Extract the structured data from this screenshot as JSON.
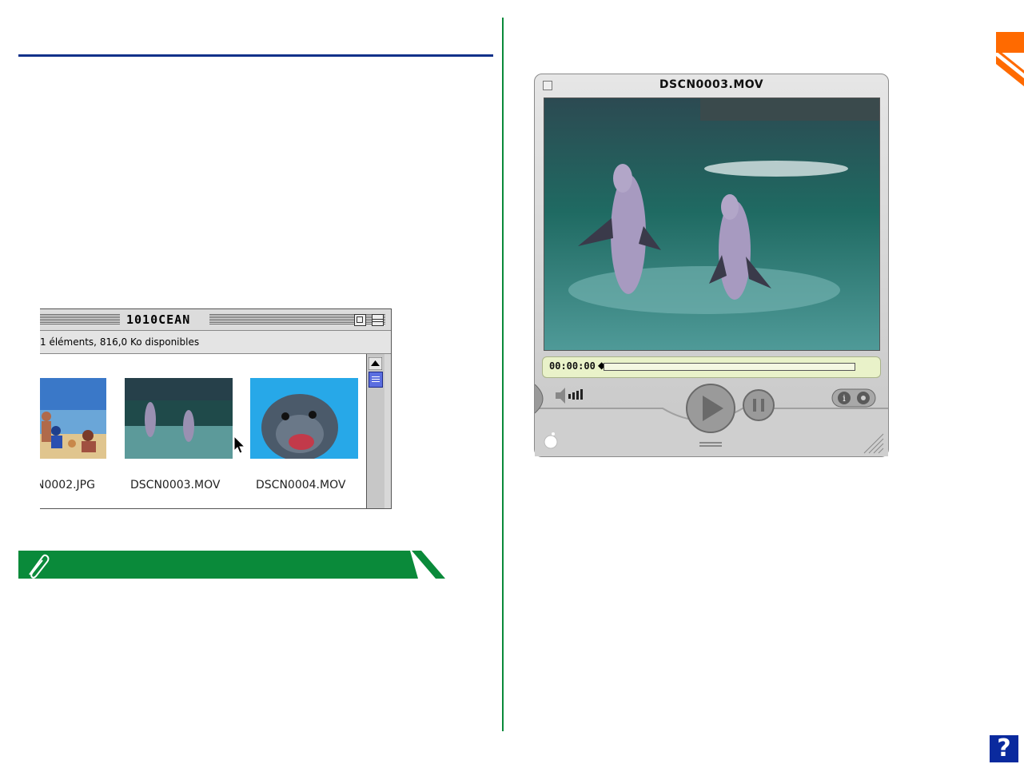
{
  "finder": {
    "title": "1010CEAN",
    "status": "1 éléments, 816,0 Ko disponibles",
    "files": [
      {
        "name": "N0002.JPG"
      },
      {
        "name": "DSCN0003.MOV"
      },
      {
        "name": "DSCN0004.MOV"
      }
    ]
  },
  "player": {
    "title": "DSCN0003.MOV",
    "timecode": "00:00:00",
    "playback_position": 0
  },
  "help": {
    "label": "?"
  },
  "colors": {
    "title_rule": "#10318a",
    "column_divider": "#0a8a3a",
    "tip_banner": "#0a8a3a",
    "corner_tab": "#ff6a00",
    "help_button": "#0a2a9e",
    "scroll_thumb": "#5b6ee0",
    "time_bar": "#e9f2c9"
  },
  "icons": {
    "tip": "paperclip-icon",
    "cursor": "mouse-pointer-icon",
    "apple": "apple-logo-icon",
    "volume": "speaker-icon",
    "play": "play-icon",
    "pause": "pause-icon",
    "info": "info-icon",
    "resize": "resize-grip-icon"
  }
}
